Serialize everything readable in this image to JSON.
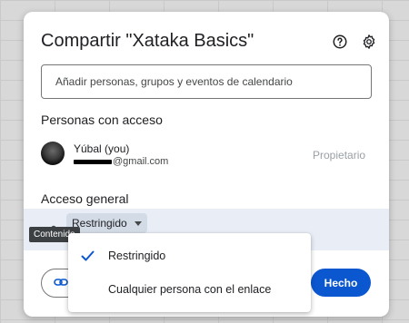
{
  "dialog": {
    "title": "Compartir \"Xataka Basics\"",
    "help_icon": "help-circle-icon",
    "settings_icon": "gear-icon"
  },
  "add_people": {
    "placeholder": "Añadir personas, grupos y eventos de calendario"
  },
  "people": {
    "heading": "Personas con acceso",
    "items": [
      {
        "name": "Yúbal (you)",
        "email_suffix": "@gmail.com",
        "role": "Propietario"
      }
    ]
  },
  "general_access": {
    "heading": "Acceso general",
    "selected": "Restringido",
    "tooltip": "Contenido",
    "options": [
      {
        "label": "Restringido",
        "selected": true
      },
      {
        "label": "Cualquier persona con el enlace",
        "selected": false
      }
    ]
  },
  "footer": {
    "done_label": "Hecho",
    "copy_link_icon": "link-icon"
  },
  "colors": {
    "primary": "#0b57d0",
    "access_row_bg": "#e9eef6",
    "text": "#202124"
  }
}
